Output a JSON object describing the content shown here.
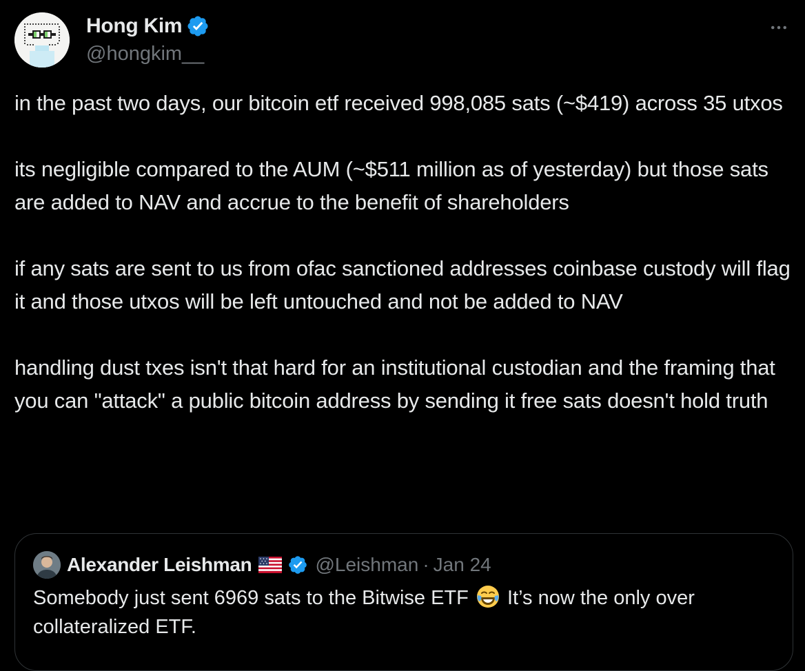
{
  "tweet": {
    "author": {
      "display_name": "Hong Kim",
      "handle": "@hongkim__",
      "verified": true,
      "avatar_icon": "pixel-art-avatar"
    },
    "more_icon": "more-horizontal-icon",
    "paragraphs": [
      "in the past two days, our bitcoin etf received 998,085 sats (~$419) across 35 utxos",
      "its negligible compared to the AUM (~$511 million as of yesterday) but those sats are added to NAV and accrue to the benefit of shareholders",
      "if any sats are sent to us from ofac sanctioned addresses coinbase custody will flag it and those utxos will be left untouched and not be added to NAV",
      "handling dust txes isn't that hard for an institutional custodian and the framing that you can \"attack\" a public bitcoin address by sending it free sats doesn't hold truth"
    ]
  },
  "quoted_tweet": {
    "author": {
      "display_name": "Alexander Leishman",
      "flag_icon": "us-flag-icon",
      "verified": true,
      "handle": "@Leishman",
      "separator": "·",
      "date": "Jan 24"
    },
    "text_before_emoji": "Somebody just sent 6969 sats to the Bitwise ETF",
    "emoji_icon": "face-with-tears-of-joy-icon",
    "text_after_emoji": " It’s now the only over collateralized ETF."
  },
  "colors": {
    "background": "#000000",
    "primary_text": "#e7e9ea",
    "secondary_text": "#71767b",
    "verified_blue": "#1d9bf0",
    "border": "#2f3336"
  }
}
